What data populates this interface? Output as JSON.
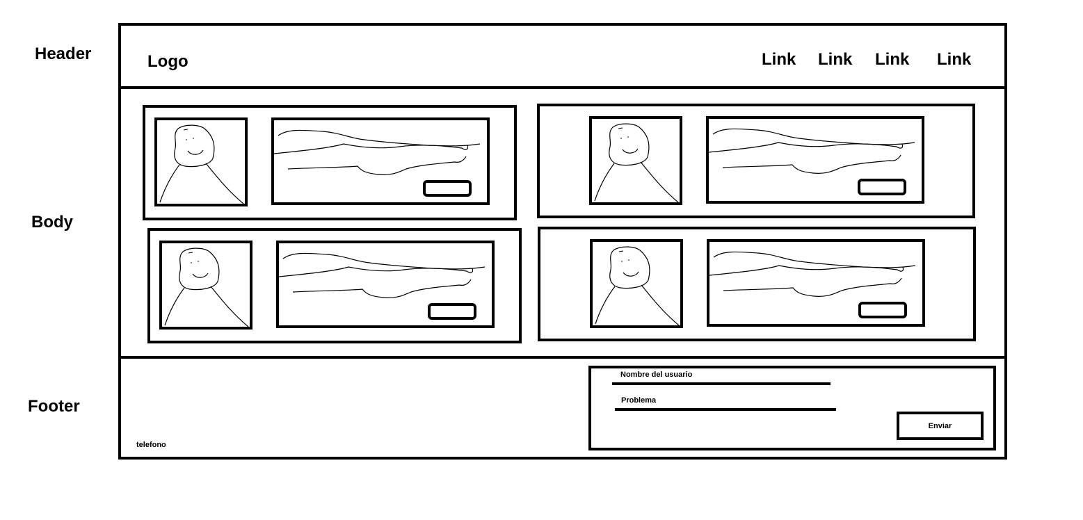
{
  "side_labels": {
    "header": "Header",
    "body": "Body",
    "footer": "Footer"
  },
  "header": {
    "logo": "Logo",
    "links": [
      "Link",
      "Link",
      "Link",
      "Link"
    ]
  },
  "body": {
    "cards": [
      {
        "avatar_icon": "person-sketch-icon",
        "text": "scribble-lines",
        "button": "button"
      },
      {
        "avatar_icon": "person-sketch-icon",
        "text": "scribble-lines",
        "button": "button"
      },
      {
        "avatar_icon": "person-sketch-icon",
        "text": "scribble-lines",
        "button": "button"
      },
      {
        "avatar_icon": "person-sketch-icon",
        "text": "scribble-lines",
        "button": "button"
      }
    ]
  },
  "footer": {
    "telefono": "telefono",
    "form": {
      "username_label": "Nombre del usuario",
      "problem_label": "Problema",
      "submit_label": "Enviar"
    }
  }
}
